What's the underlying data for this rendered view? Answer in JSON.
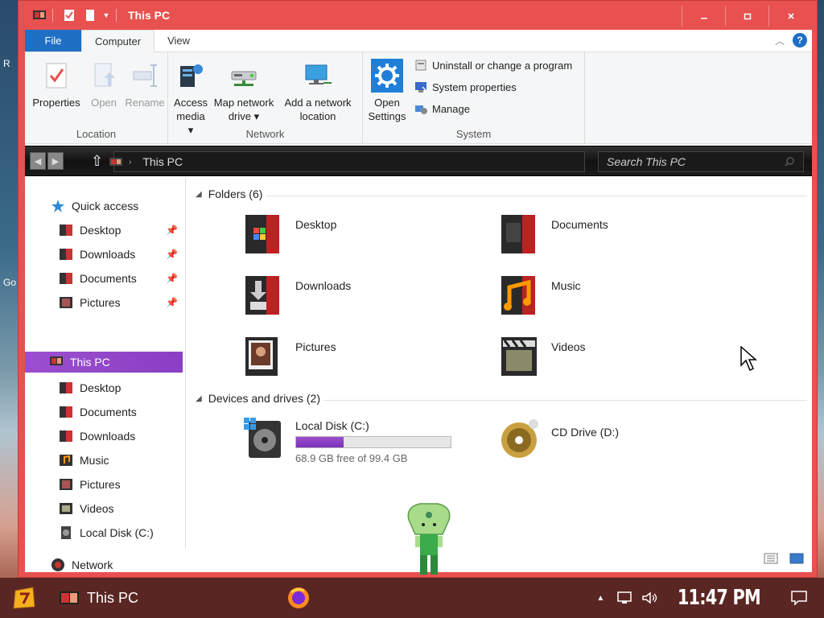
{
  "desktop": {
    "labels": [
      "R",
      "Go"
    ]
  },
  "window": {
    "title": "This PC"
  },
  "ribbon": {
    "tabs": [
      {
        "label": "File"
      },
      {
        "label": "Computer"
      },
      {
        "label": "View"
      }
    ],
    "location": {
      "label": "Location",
      "properties": "Properties",
      "open": "Open",
      "rename": "Rename"
    },
    "network": {
      "label": "Network",
      "access_media": [
        "Access",
        "media ▾"
      ],
      "map_drive": [
        "Map network",
        "drive ▾"
      ],
      "add_location": [
        "Add a network",
        "location"
      ]
    },
    "system": {
      "label": "System",
      "open_settings": [
        "Open",
        "Settings"
      ],
      "uninstall": "Uninstall or change a program",
      "system_properties": "System properties",
      "manage": "Manage"
    }
  },
  "address": {
    "path": "This PC",
    "search_placeholder": "Search This PC"
  },
  "nav": {
    "quick_access": "Quick access",
    "quick_items": [
      "Desktop",
      "Downloads",
      "Documents",
      "Pictures"
    ],
    "this_pc": "This PC",
    "pc_items": [
      "Desktop",
      "Documents",
      "Downloads",
      "Music",
      "Pictures",
      "Videos",
      "Local Disk (C:)"
    ],
    "network": "Network"
  },
  "content": {
    "folders_header": "Folders (6)",
    "folders": [
      "Desktop",
      "Documents",
      "Downloads",
      "Music",
      "Pictures",
      "Videos"
    ],
    "drives_header": "Devices and drives (2)",
    "drives": [
      {
        "name": "Local Disk (C:)",
        "free_text": "68.9 GB free of 99.4 GB",
        "used_fraction": 0.307
      },
      {
        "name": "CD Drive (D:)"
      }
    ]
  },
  "taskbar": {
    "app_label": "This PC",
    "clock": "11:47 PM"
  },
  "colors": {
    "window_frame": "#e8514f",
    "accent": "#1f6fc5",
    "selection": "#9b4fcf",
    "taskbar": "#5a2623"
  }
}
